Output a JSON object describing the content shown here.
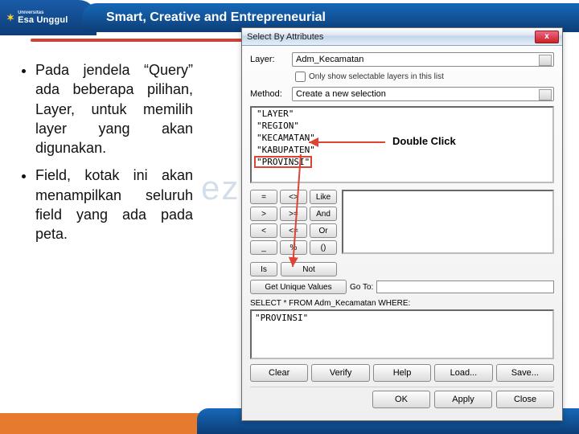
{
  "header": {
    "university_prefix": "Universitas",
    "university_name": "Esa Unggul",
    "tagline": "Smart, Creative and Entrepreneurial"
  },
  "bullets": {
    "b1": "Pada jendela “Query” ada beberapa pilihan, Layer, untuk memilih layer yang akan digunakan.",
    "b2": "Field, kotak ini akan menampilkan seluruh field yang ada pada peta."
  },
  "watermark": "ezadja. blogspot.",
  "annotation": {
    "double_click": "Double Click"
  },
  "dialog": {
    "title": "Select By Attributes",
    "close": "x",
    "labels": {
      "layer": "Layer:",
      "only_show": "Only show selectable layers in this list",
      "method": "Method:",
      "get_unique": "Get Unique Values",
      "go_to": "Go To:",
      "select_from": "SELECT * FROM Adm_Kecamatan WHERE:"
    },
    "layer_value": "Adm_Kecamatan",
    "method_value": "Create a new selection",
    "fields": [
      "\"LAYER\"",
      "\"REGION\"",
      "\"KECAMATAN\"",
      "\"KABUPATEN\"",
      "\"PROVINSI\""
    ],
    "operators": {
      "row1": [
        "=",
        "<>",
        "Like"
      ],
      "row2": [
        ">",
        ">=",
        "And"
      ],
      "row3": [
        "<",
        "<=",
        "Or"
      ],
      "row4a": [
        "_",
        "%",
        "()"
      ],
      "not": "Not",
      "is": "Is"
    },
    "query_text": "\"PROVINSI\"",
    "buttons": {
      "clear": "Clear",
      "verify": "Verify",
      "help": "Help",
      "load": "Load...",
      "save": "Save...",
      "ok": "OK",
      "apply": "Apply",
      "close": "Close"
    }
  }
}
